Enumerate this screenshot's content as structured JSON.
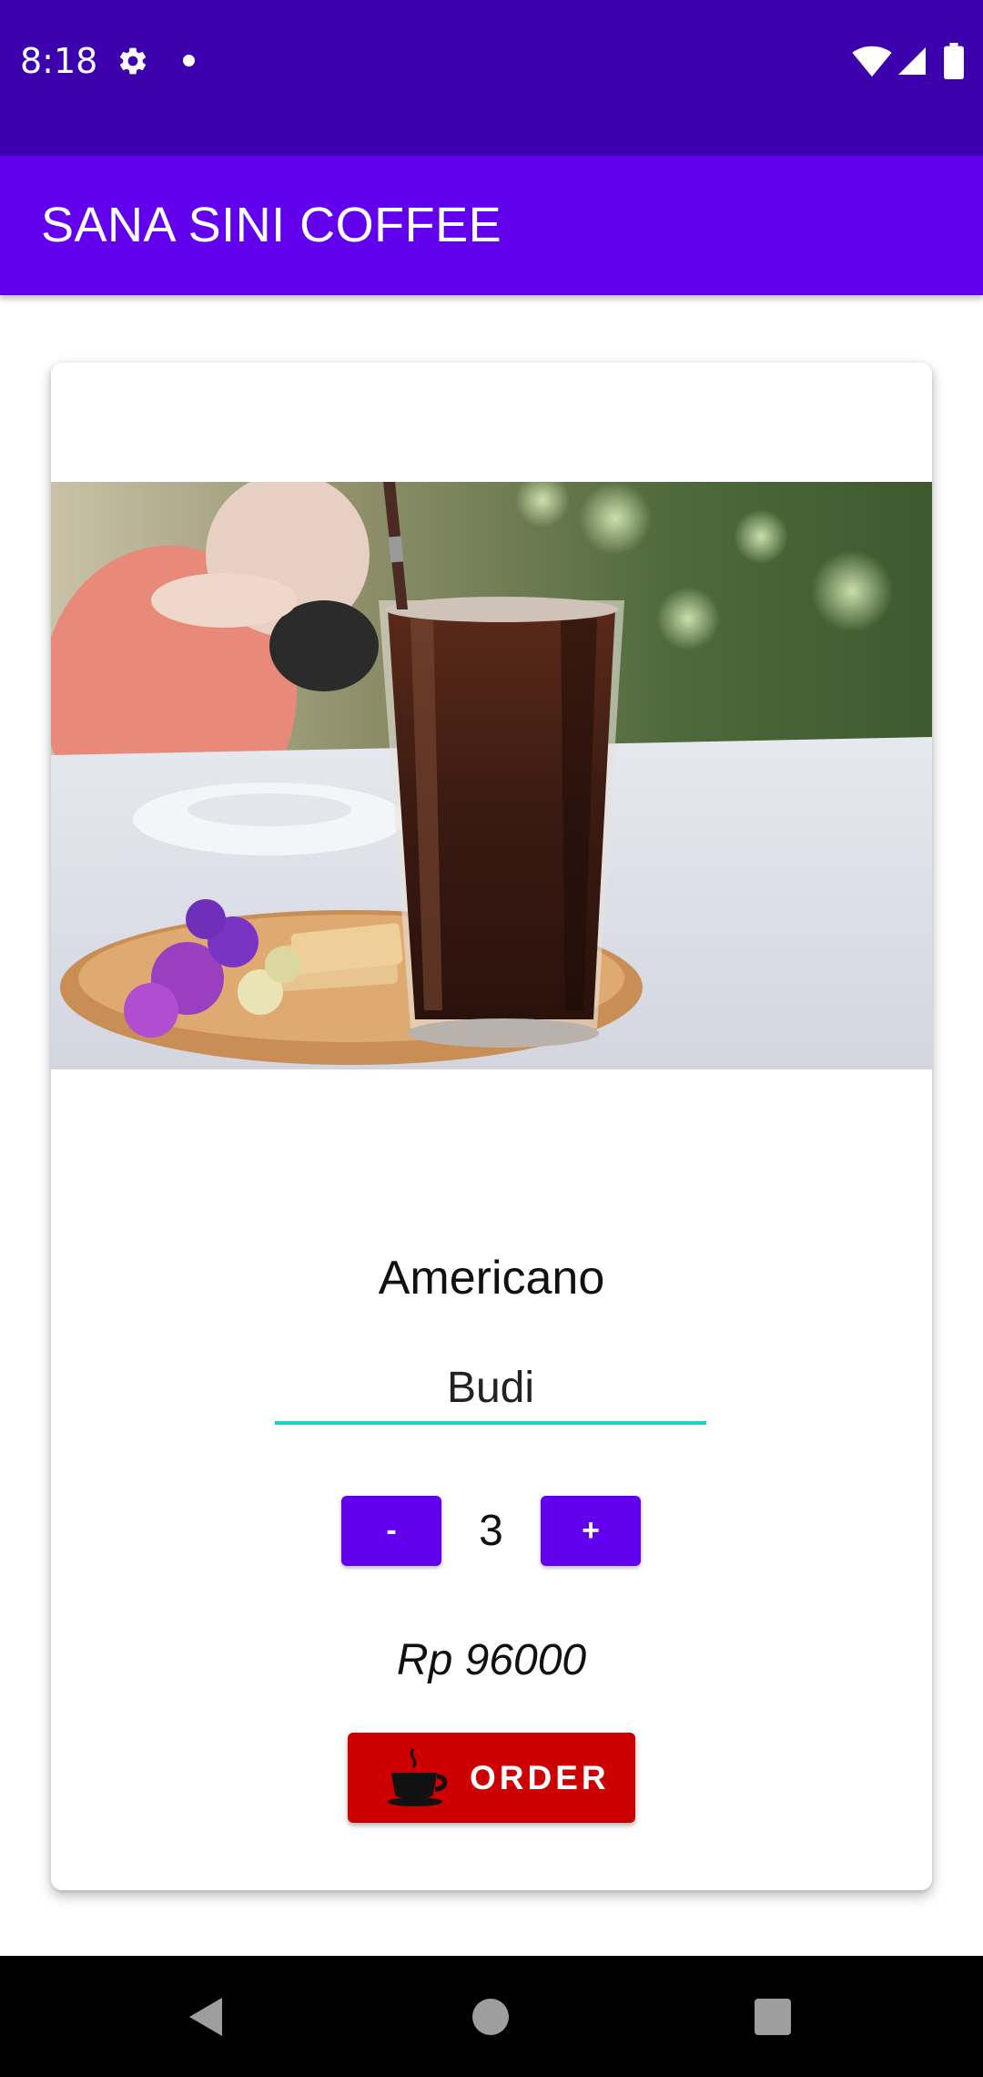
{
  "status_bar": {
    "time": "8:18",
    "icons": [
      "gear-icon",
      "notification-dot-icon",
      "wifi-icon",
      "signal-icon",
      "battery-icon"
    ]
  },
  "app_bar": {
    "title": "SANA SINI COFFEE",
    "color": "#6200ee"
  },
  "card": {
    "product_image": "iced-americano-photo",
    "product_name": "Americano",
    "customer_name": "Budi",
    "customer_name_placeholder": "",
    "quantity": {
      "minus_label": "-",
      "value": "3",
      "plus_label": "+"
    },
    "price": "Rp 96000",
    "order_button": {
      "label": "ORDER",
      "icon": "coffee-cup-icon",
      "color": "#cc0000"
    }
  },
  "colors": {
    "status_bar": "#3c00ad",
    "accent": "#6200ee",
    "input_underline": "#1fd1c9",
    "order": "#cc0000"
  },
  "nav_bar": {
    "icons": [
      "back-icon",
      "home-icon",
      "recents-icon"
    ]
  }
}
